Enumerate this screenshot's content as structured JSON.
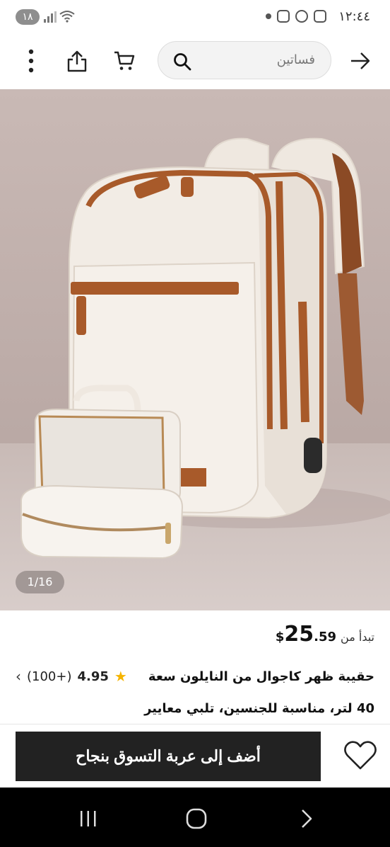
{
  "status_bar": {
    "time": "١٢:٤٤",
    "battery": "١٨"
  },
  "topnav": {
    "search_text": "فساتين",
    "icons": [
      "back-arrow-icon",
      "search-icon",
      "cart-icon",
      "share-icon",
      "more-vertical-icon"
    ]
  },
  "gallery": {
    "pager": "1/16"
  },
  "product": {
    "price_prefix": "تبدأ من",
    "price_currency": "$",
    "price_whole": "25",
    "price_fraction": ".59",
    "title_line1": "حقيبة ظهر كاجوال من النايلون سعة",
    "title_line2": "40 لتر، مناسبة للجنسين، تلبي معايير",
    "rating_score": "4.95",
    "rating_count": "(100+)"
  },
  "actions": {
    "add_to_cart": "أضف إلى عربة التسوق بنجاح"
  },
  "colors": {
    "accent_dark": "#222222",
    "star": "#f5b400",
    "hero_bg": "#cbbcb8",
    "bag": "#f1ebe4",
    "trim": "#a85a2a"
  }
}
